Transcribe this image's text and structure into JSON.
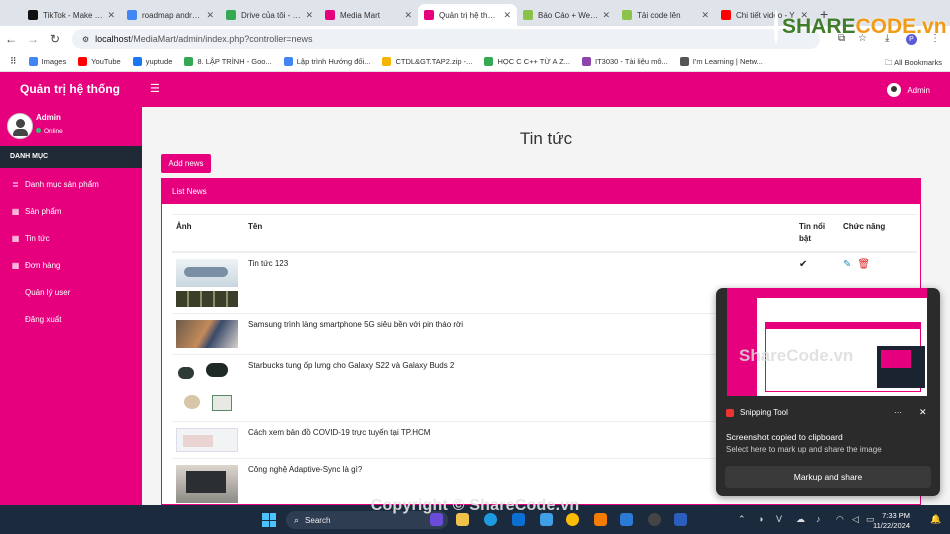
{
  "browser": {
    "tabs": [
      {
        "label": "TikTok - Make Yo",
        "color": "#111111"
      },
      {
        "label": "roadmap android",
        "color": "#4285f4"
      },
      {
        "label": "Drive của tôi - Go",
        "color": "#34a853"
      },
      {
        "label": "Media Mart",
        "color": "#e6007e"
      },
      {
        "label": "Quản trị hệ thống",
        "color": "#e6007e",
        "active": true
      },
      {
        "label": "Báo Cáo + Webs",
        "color": "#8bc34a"
      },
      {
        "label": "Tải code lên",
        "color": "#8bc34a"
      },
      {
        "label": "Chi tiết video - Y",
        "color": "#ff0000"
      }
    ],
    "url_host": "localhost",
    "url_path": "/MediaMart/admin/index.php?controller=news",
    "bookmarks": [
      {
        "label": "Images",
        "color": "#4285f4"
      },
      {
        "label": "YouTube",
        "color": "#ff0000"
      },
      {
        "label": "yuptude",
        "color": "#1877f2"
      },
      {
        "label": "8. LẬP TRÌNH - Goo...",
        "color": "#34a853"
      },
      {
        "label": "Lập trình Hướng đối...",
        "color": "#4285f4"
      },
      {
        "label": "CTDL&GT.TAP2.zip -...",
        "color": "#f4b400"
      },
      {
        "label": "HỌC C C++ TỪ A Z...",
        "color": "#34a853"
      },
      {
        "label": "IT3030 - Tài liệu mô...",
        "color": "#8e44ad"
      },
      {
        "label": "I'm Learning | Netw...",
        "color": "#555555"
      }
    ],
    "all_bookmarks": "All Bookmarks"
  },
  "app": {
    "brand": "Quản trị hệ thống",
    "header_user": "Admin",
    "sidebar": {
      "user_name": "Admin",
      "user_status": "Online",
      "section": "DANH MỤC",
      "items": [
        {
          "label": "Danh mục sản phẩm",
          "icon": "list-icon"
        },
        {
          "label": "Sản phẩm",
          "icon": "table-icon"
        },
        {
          "label": "Tin tức",
          "icon": "table-icon"
        },
        {
          "label": "Đơn hàng",
          "icon": "table-icon"
        },
        {
          "label": "Quản lý user",
          "icon": "code-icon"
        },
        {
          "label": "Đăng xuất",
          "icon": "code-icon"
        }
      ]
    },
    "page_title": "Tin tức",
    "add_button": "Add news",
    "card_title": "List News",
    "table": {
      "headers": {
        "image": "Ảnh",
        "name": "Tên",
        "featured": "Tin nổi bật",
        "actions": "Chức năng"
      },
      "rows": [
        {
          "name": "Tin tức 123",
          "featured": true
        },
        {
          "name": "Samsung trình làng smartphone 5G siêu bền với pin tháo rời",
          "featured": false
        },
        {
          "name": "Starbucks tung ốp lưng cho Galaxy S22 và Galaxy Buds 2",
          "featured": false
        },
        {
          "name": "Cách xem bản đồ COVID-19 trực tuyến tại TP.HCM",
          "featured": false
        },
        {
          "name": "Công nghệ Adaptive-Sync là gì?",
          "featured": false
        }
      ]
    }
  },
  "notification": {
    "app": "Snipping Tool",
    "title": "Screenshot copied to clipboard",
    "body": "Select here to mark up and share the image",
    "button": "Markup and share",
    "preview_watermark": "ShareCode.vn"
  },
  "watermark": {
    "logo_a": "SHARE",
    "logo_b": "CODE.vn",
    "copyright": "Copyright © ShareCode.vn"
  },
  "taskbar": {
    "search": "Search",
    "time": "7:33 PM",
    "date": "11/22/2024"
  }
}
